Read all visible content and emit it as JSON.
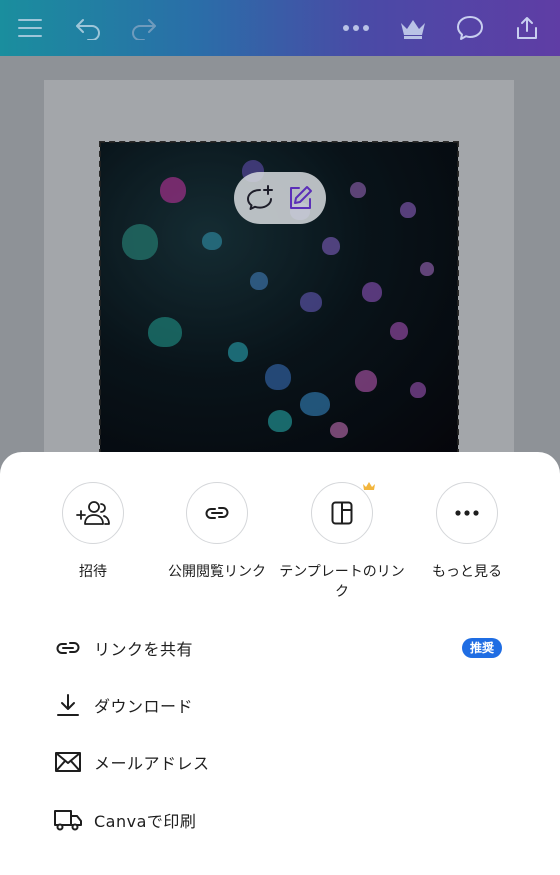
{
  "topbar": {
    "icons": [
      "menu-icon",
      "undo-icon",
      "redo-icon",
      "more-icon",
      "crown-icon",
      "comment-icon",
      "share-icon"
    ]
  },
  "canvas": {
    "float_toolbar_icons": [
      "add-comment-icon",
      "edit-icon"
    ]
  },
  "share_sheet": {
    "options": [
      {
        "label": "招待",
        "icon": "invite-icon"
      },
      {
        "label": "公開閲覧リンク",
        "icon": "link-icon"
      },
      {
        "label": "テンプレートのリンク",
        "icon": "template-icon",
        "pro": true
      },
      {
        "label": "もっと見る",
        "icon": "more-icon"
      }
    ],
    "rows": [
      {
        "label": "リンクを共有",
        "icon": "link-icon",
        "badge": "推奨"
      },
      {
        "label": "ダウンロード",
        "icon": "download-icon"
      },
      {
        "label": "メールアドレス",
        "icon": "mail-icon"
      },
      {
        "label": "Canvaで印刷",
        "icon": "truck-icon"
      }
    ],
    "colors": {
      "badge": "#1f6de3",
      "crown": "#f2b53d"
    }
  }
}
